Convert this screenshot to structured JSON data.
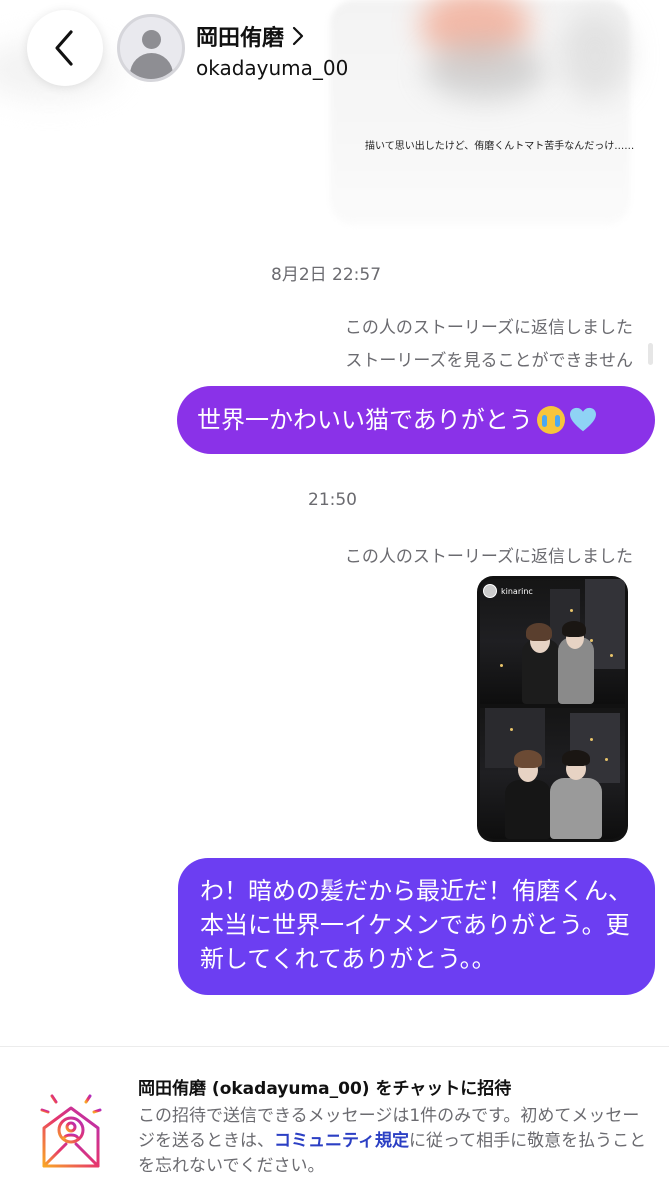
{
  "header": {
    "name": "岡田侑磨",
    "username": "okadayuma_00"
  },
  "previous_story": {
    "caption": "描いて思い出したけど、侑磨くんトマト苦手なんだっけ……"
  },
  "messages": {
    "timestamp_1": "8月2日 22:57",
    "note_replied_1": "この人のストーリーズに返信しました",
    "note_unavailable": "ストーリーズを見ることができません",
    "bubble_1_text": "世界一かわいい猫でありがとう",
    "timestamp_2": "21:50",
    "note_replied_2": "この人のストーリーズに返信しました",
    "story_username": "kinarinc",
    "bubble_2_text": "わ！暗めの髪だから最近だ！侑磨くん、本当に世界一イケメンでありがとう。更新してくれてありがとう。。"
  },
  "invite": {
    "title": "岡田侑磨 (okadayuma_00) をチャットに招待",
    "body_before": "この招待で送信できるメッセージは1件のみです。初めてメッセージを送るときは、",
    "link": "コミュニティ規定",
    "body_after": "に従って相手に敬意を払うことを忘れないでください。"
  },
  "colors": {
    "bubble_1": "#8a32e8",
    "bubble_2": "#6c3ef2",
    "link": "#2b3fc4",
    "muted_text": "#6b6b70"
  },
  "icons": {
    "back": "chevron-left-icon",
    "header_arrow": "chevron-right-icon",
    "avatar": "default-avatar-icon",
    "invite": "envelope-invite-icon",
    "emoji_1": "loudly-crying-face-emoji",
    "emoji_2": "light-blue-heart-emoji"
  }
}
